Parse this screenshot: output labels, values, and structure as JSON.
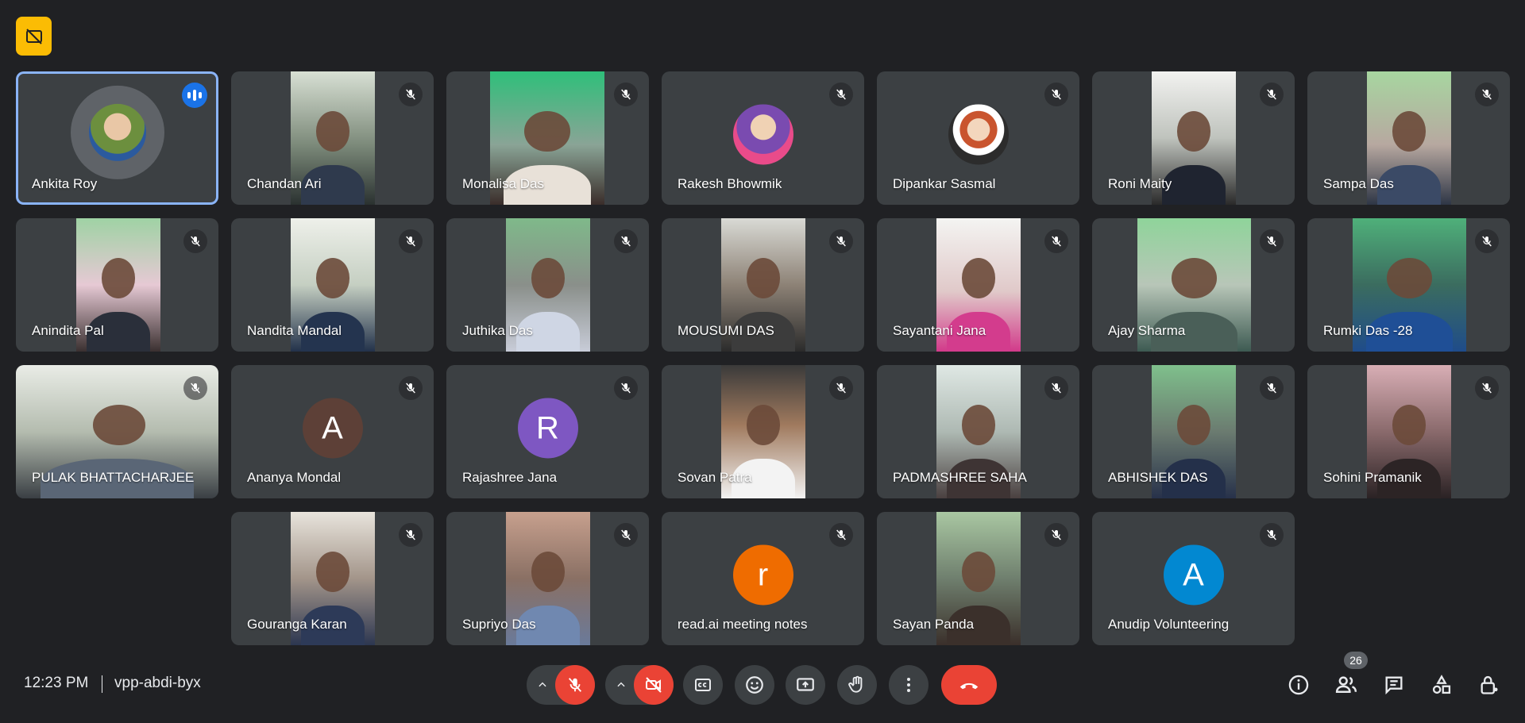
{
  "meeting": {
    "time": "12:23 PM",
    "code": "vpp-abdi-byx",
    "participant_count": "26"
  },
  "colors": {
    "background": "#202124",
    "tile": "#3c4043",
    "accent_blue": "#1a73e8",
    "end_red": "#ea4335",
    "badge_yellow": "#fbbc04"
  },
  "participants": [
    {
      "name": "Ankita Roy"
    },
    {
      "name": "Chandan Ari"
    },
    {
      "name": "Monalisa Das"
    },
    {
      "name": "Rakesh Bhowmik"
    },
    {
      "name": "Dipankar Sasmal"
    },
    {
      "name": "Roni Maity"
    },
    {
      "name": "Sampa Das"
    },
    {
      "name": "Anindita Pal"
    },
    {
      "name": "Nandita Mandal"
    },
    {
      "name": "Juthika Das"
    },
    {
      "name": "MOUSUMI DAS"
    },
    {
      "name": "Sayantani Jana"
    },
    {
      "name": "Ajay Sharma"
    },
    {
      "name": "Rumki Das -28"
    },
    {
      "name": "PULAK BHATTACHARJEE"
    },
    {
      "name": "Ananya Mondal",
      "initial": "A"
    },
    {
      "name": "Rajashree Jana",
      "initial": "R"
    },
    {
      "name": "Sovan Patra"
    },
    {
      "name": "PADMASHREE SAHA"
    },
    {
      "name": "ABHISHEK DAS"
    },
    {
      "name": "Sohini Pramanik"
    },
    {
      "name": "Gouranga Karan"
    },
    {
      "name": "Supriyo Das"
    },
    {
      "name": "read.ai meeting notes",
      "initial": "r"
    },
    {
      "name": "Sayan Panda"
    },
    {
      "name": "Anudip Volunteering",
      "initial": "A"
    }
  ]
}
